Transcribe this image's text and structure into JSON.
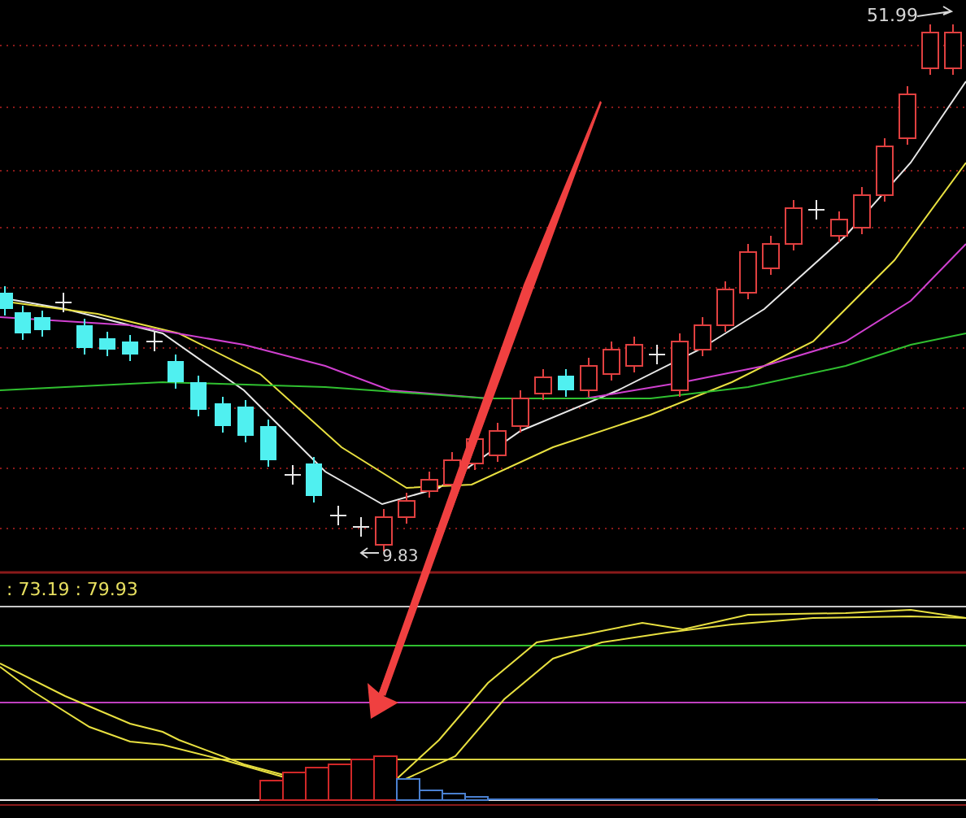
{
  "price_panel": {
    "high_label": "51.99",
    "low_label": "9.83"
  },
  "indicator_panel": {
    "readout": ": 73.19 : 79.93"
  }
}
